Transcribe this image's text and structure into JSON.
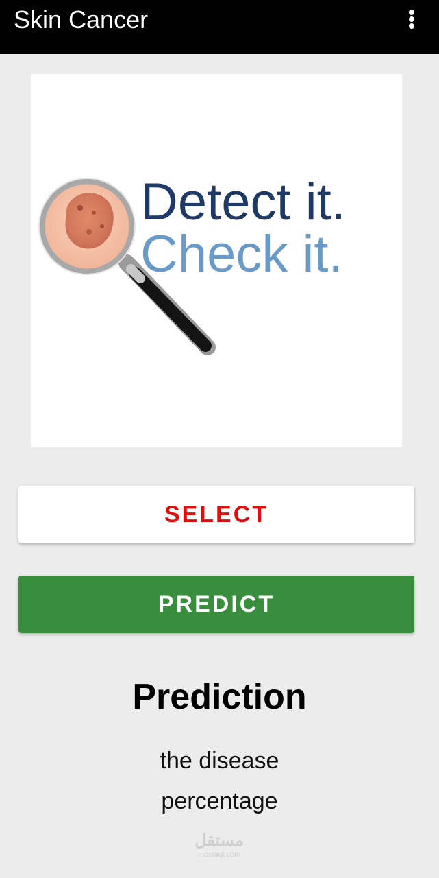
{
  "app_bar": {
    "title": "Skin Cancer",
    "menu_icon": "more-vert-icon"
  },
  "image": {
    "logo_line1": "Detect it.",
    "logo_line2": "Check it.",
    "colors": {
      "line1": "#1f3a66",
      "line2": "#6a9bc8"
    }
  },
  "buttons": {
    "select_label": "SELECT",
    "predict_label": "PREDICT"
  },
  "prediction": {
    "heading": "Prediction",
    "result_text": "the disease percentage"
  },
  "watermark": {
    "arabic": "مستقل",
    "latin": "mostaql.com"
  },
  "colors": {
    "app_bar": "#000000",
    "background": "#ececec",
    "select_text": "#dd1010",
    "predict_button": "#388e3c"
  }
}
